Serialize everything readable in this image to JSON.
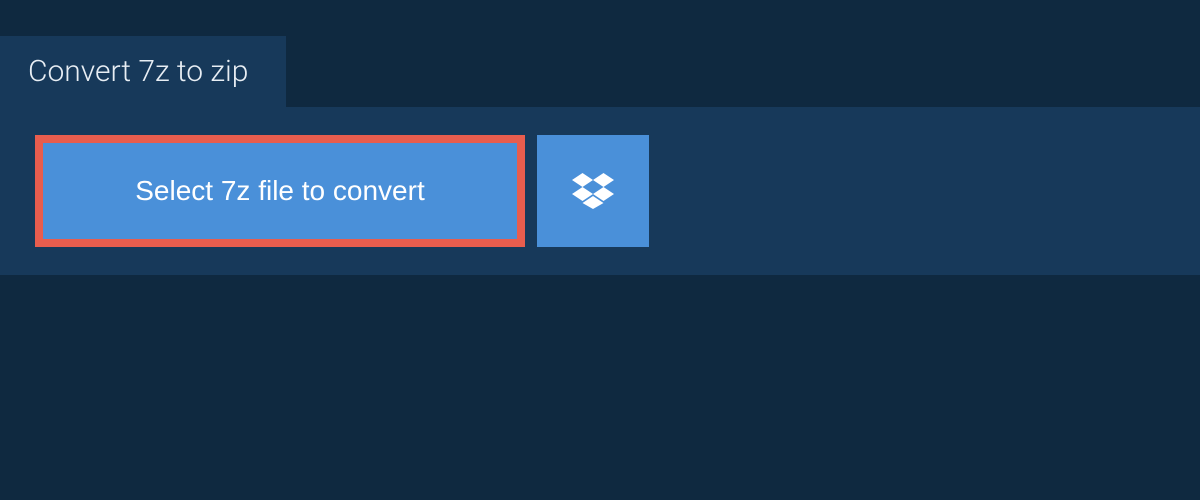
{
  "header": {
    "title": "Convert 7z to zip"
  },
  "actions": {
    "select_label": "Select 7z file to convert"
  },
  "colors": {
    "background": "#0f2940",
    "panel": "#17395a",
    "button": "#4a90d9",
    "highlight_border": "#e85d4e",
    "text_light": "#e8eef4",
    "text_white": "#ffffff"
  }
}
